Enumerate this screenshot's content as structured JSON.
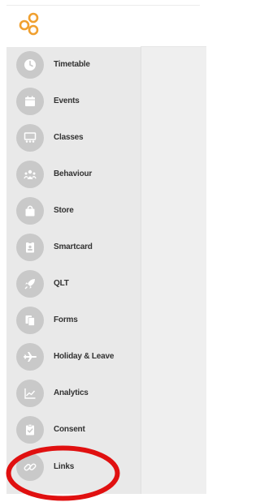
{
  "sidebar": {
    "items": [
      {
        "label": "Timetable",
        "icon": "clock-icon"
      },
      {
        "label": "Events",
        "icon": "calendar-icon"
      },
      {
        "label": "Classes",
        "icon": "classroom-icon"
      },
      {
        "label": "Behaviour",
        "icon": "people-icon"
      },
      {
        "label": "Store",
        "icon": "shopping-bag-icon"
      },
      {
        "label": "Smartcard",
        "icon": "id-card-icon"
      },
      {
        "label": "QLT",
        "icon": "rocket-icon"
      },
      {
        "label": "Forms",
        "icon": "documents-icon"
      },
      {
        "label": "Holiday & Leave",
        "icon": "airplane-icon"
      },
      {
        "label": "Analytics",
        "icon": "line-chart-icon"
      },
      {
        "label": "Consent",
        "icon": "clipboard-check-icon"
      },
      {
        "label": "Links",
        "icon": "link-icon"
      }
    ]
  },
  "colors": {
    "brand": "#f0a030",
    "sidebar_bg": "#e9e9e9",
    "icon_circle": "#c9c9c9",
    "annotation": "#e01010"
  }
}
